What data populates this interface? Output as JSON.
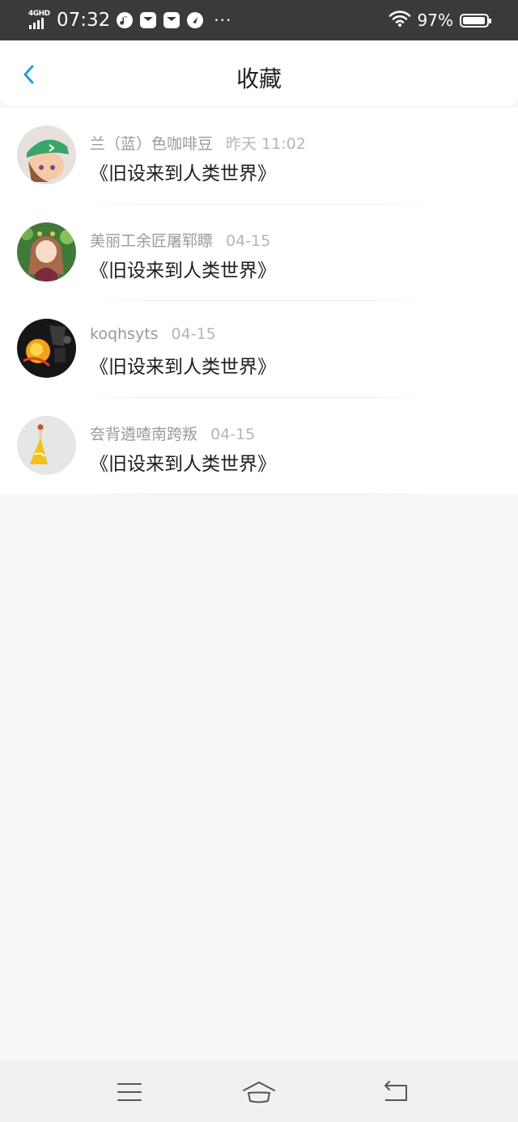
{
  "status_bar": {
    "network": "4GHD",
    "time": "07:32",
    "more": "···",
    "battery": "97%",
    "battery_level": 0.97
  },
  "header": {
    "title": "收藏",
    "back_icon": "chevron-left-icon",
    "accent": "#1e9fe8"
  },
  "favorites": [
    {
      "author": "兰（蓝）色咖啡豆",
      "time": "昨天 11:02",
      "title": "《旧设来到人类世界》",
      "avatar": "green-cap-character"
    },
    {
      "author": "美丽工余匠屠郓瞟",
      "time": "04-15",
      "title": "《旧设来到人类世界》",
      "avatar": "flower-girl"
    },
    {
      "author": "koqhsyts",
      "time": "04-15",
      "title": "《旧设来到人类世界》",
      "avatar": "drink-splash"
    },
    {
      "author": "夽背遴喳南跨叛",
      "time": "04-15",
      "title": "《旧设来到人类世界》",
      "avatar": "yellow-dress-figure"
    }
  ],
  "nav_bar": {
    "menu_icon": "menu-icon",
    "home_icon": "home-icon",
    "back_icon": "back-icon"
  }
}
